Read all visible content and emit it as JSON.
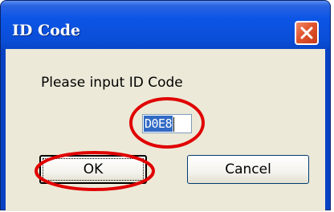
{
  "dialog": {
    "title": "ID Code",
    "prompt": "Please input ID Code",
    "input_value": "D0E8",
    "ok_label": "OK",
    "cancel_label": "Cancel"
  },
  "colors": {
    "titlebar": "#0a4ed8",
    "close_button": "#e0552d",
    "client_bg": "#ece9d8",
    "selection": "#316ac5",
    "annotation": "#e00000"
  },
  "icons": {
    "close": "close-icon"
  }
}
